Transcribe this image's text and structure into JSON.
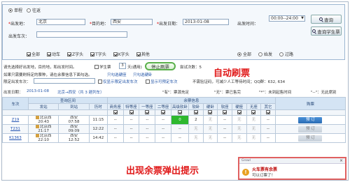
{
  "trip": {
    "one_way": "单程",
    "round_trip": "往返"
  },
  "search": {
    "from_label": "出发地：",
    "from_value": "北京",
    "to_label": "目的地：",
    "to_value": "西安",
    "date_label": "出发日期：",
    "date_value": "2013-01-08",
    "time_label": "出发时间：",
    "time_value": "00:00--24:00",
    "train_no_label": "出发车次：",
    "query_button": "查询",
    "student_query_button": "查询学生票"
  },
  "train_types": {
    "all": "全部",
    "items": [
      "动车",
      "Z字头",
      "T字头",
      "K字头",
      "其他"
    ]
  },
  "passenger_types": [
    "全部",
    "始发",
    "过路"
  ],
  "options": {
    "line1": "请先选择好出发地，目的地，和出发时间。",
    "student_label": "学生票",
    "interval_value": "3",
    "interval_unit": "天(通用)",
    "refresh_button": "停止刷票",
    "attempts": "尝试次数：5",
    "line2": "如果只需要刷特定的票种，请在余票信息下面勾选。",
    "only_link1": "只勾选硬座",
    "only_link2": "只勾选硬卧",
    "line3_label": "限定出发车次：",
    "cb_restrict": "仅显示限定出发车次",
    "cb_show": "显示可预定车次",
    "tips": "不需验证码，可减少人工等待时间；QQ群：632, 634"
  },
  "annotations": {
    "auto_refresh": "自动刷票",
    "popup_tip": "出现余票弹出提示"
  },
  "summary": {
    "date_label": "出发日期：",
    "date": "2013-01-08",
    "route": "北京→西安（共 3 趟列车）",
    "legend_have": "\"有\"：票源充足",
    "legend_none": "\"无\"：票已售完",
    "legend_star": "\"*\"：未到起售时间",
    "legend_dash": "\"--\"：无此席别"
  },
  "table": {
    "group_headers": {
      "train": "车次",
      "interval": "查询区间",
      "seat_info": "余票信息",
      "book": "购票"
    },
    "headers": [
      "车次",
      "发站",
      "到站",
      "历时",
      "商务座",
      "特等座",
      "一等座",
      "二等座",
      "高级软卧",
      "软卧",
      "硬卧",
      "软座",
      "硬座",
      "无座",
      "其它",
      "购票"
    ],
    "rows": [
      {
        "train": "Z19",
        "from_station": "北京西",
        "from_time": "20:43",
        "to_station": "西安",
        "to_time": "07:58",
        "duration": "11:15",
        "seats": [
          "--",
          "--",
          "--",
          "--",
          "0",
          "2",
          "无",
          "--",
          "无",
          "无",
          "--"
        ],
        "book": "预 订",
        "bookable": true
      },
      {
        "train": "T231",
        "from_station": "北京西",
        "from_time": "21:17",
        "to_station": "西安",
        "to_time": "09:09",
        "duration": "12:22",
        "seats": [
          "--",
          "--",
          "--",
          "--",
          "--",
          "无",
          "无",
          "--",
          "无",
          "无",
          "--"
        ],
        "book": "预 订",
        "bookable": false
      },
      {
        "train": "K1363",
        "from_station": "北京西",
        "from_time": "22:10",
        "to_station": "西安",
        "to_time": "12:52",
        "duration": "14:42",
        "seats": [
          "--",
          "--",
          "--",
          "--",
          "--",
          "无",
          "无",
          "--",
          "无",
          "无",
          "--"
        ],
        "book": "预 订",
        "bookable": false
      }
    ]
  },
  "popup": {
    "header": "Growl",
    "title": "火车票有余票",
    "message": "可以订票了！"
  },
  "colors": {
    "accent_blue": "#2a6cb4",
    "annotation_red": "#e01818",
    "available_green": "#2eb82e",
    "refresh_border": "#5ab04b"
  }
}
